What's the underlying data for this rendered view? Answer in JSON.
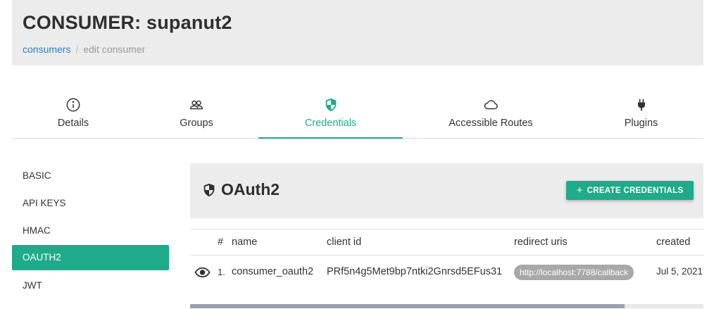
{
  "header": {
    "title": "CONSUMER: supanut2",
    "breadcrumb": {
      "link": "consumers",
      "separator": "/",
      "current": "edit consumer"
    }
  },
  "tabs": [
    {
      "label": "Details",
      "icon": "info-icon",
      "active": false
    },
    {
      "label": "Groups",
      "icon": "groups-icon",
      "active": false
    },
    {
      "label": "Credentials",
      "icon": "shield-icon",
      "active": true
    },
    {
      "label": "Accessible Routes",
      "icon": "cloud-icon",
      "active": false
    },
    {
      "label": "Plugins",
      "icon": "plug-icon",
      "active": false
    }
  ],
  "sidebar": {
    "items": [
      {
        "label": "BASIC",
        "active": false
      },
      {
        "label": "API KEYS",
        "active": false
      },
      {
        "label": "HMAC",
        "active": false
      },
      {
        "label": "OAUTH2",
        "active": true
      },
      {
        "label": "JWT",
        "active": false
      }
    ]
  },
  "panel": {
    "title": "OAuth2",
    "icon": "shield-icon",
    "create_button": {
      "label": "CREATE CREDENTIALS",
      "icon": "plus-icon"
    }
  },
  "table": {
    "columns": [
      "#",
      "name",
      "client id",
      "redirect uris",
      "created"
    ],
    "rows": [
      {
        "index": "1.",
        "name": "consumer_oauth2",
        "client_id": "PRf5n4g5Met9bp7ntki2Gnrsd5EFus31",
        "redirect_uri": "http://localhost:7788/callback",
        "created": "Jul 5, 2021",
        "action_icon": "eye-icon"
      }
    ],
    "scroll_fraction_visible": 0.85
  },
  "colors": {
    "accent": "#1fab89",
    "link": "#2d7fc6",
    "header_bg": "#ececec",
    "chip_bg": "#a8a8a8"
  }
}
